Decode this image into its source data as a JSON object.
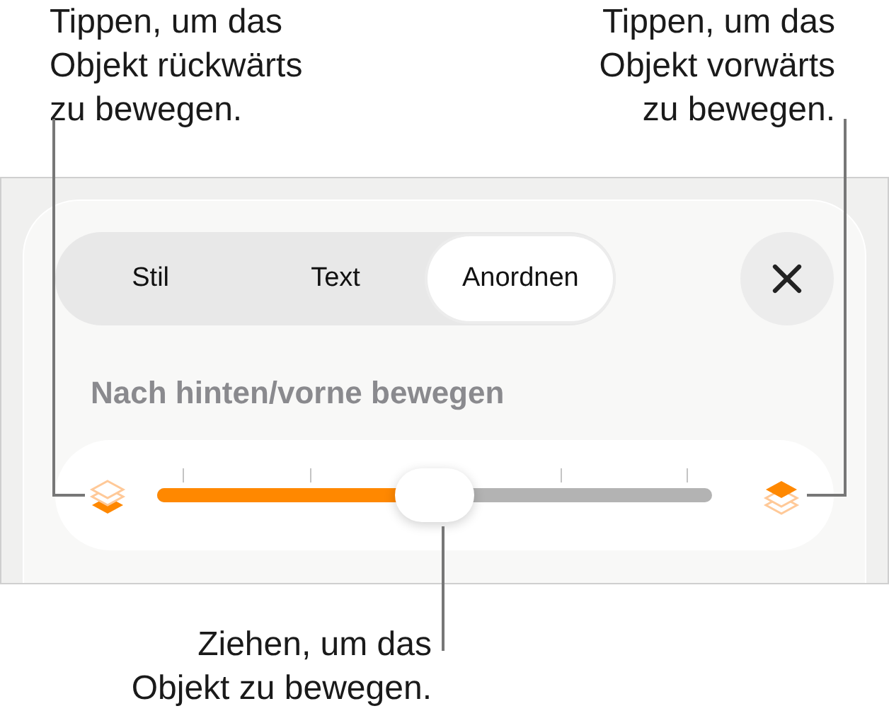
{
  "callouts": {
    "top_left": "Tippen, um das\nObjekt rückwärts\nzu bewegen.",
    "top_right": "Tippen, um das\nObjekt vorwärts\nzu bewegen.",
    "bottom": "Ziehen, um das\nObjekt zu bewegen."
  },
  "tabs": [
    {
      "label": "Stil",
      "selected": false
    },
    {
      "label": "Text",
      "selected": false
    },
    {
      "label": "Anordnen",
      "selected": true
    }
  ],
  "section_title": "Nach hinten/vorne bewegen",
  "slider": {
    "level": 0.5
  }
}
